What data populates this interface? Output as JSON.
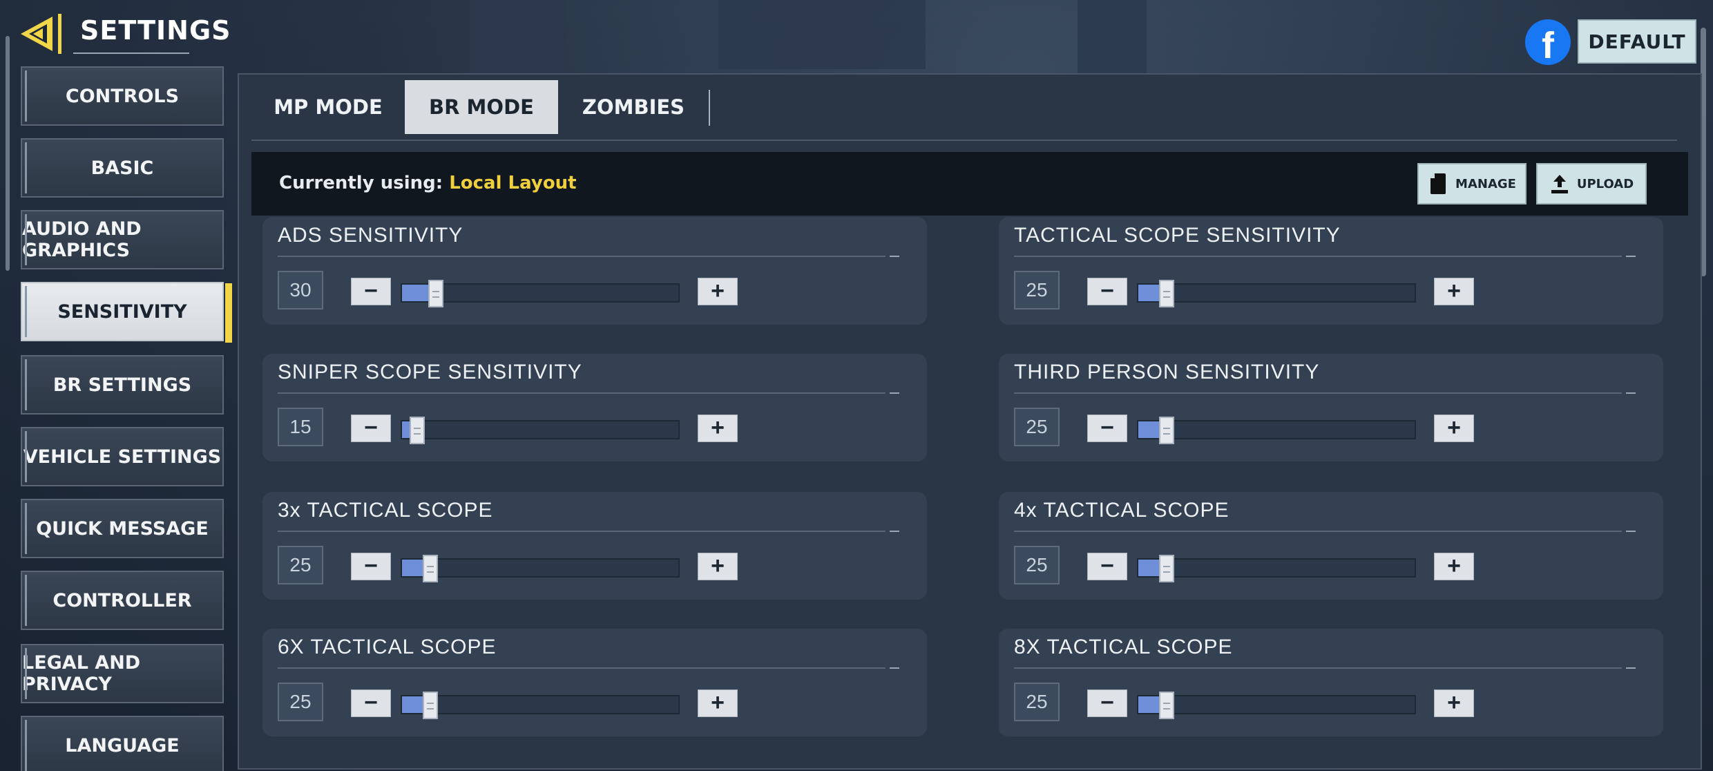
{
  "header": {
    "title": "SETTINGS",
    "default_label": "DEFAULT",
    "facebook_glyph": "f"
  },
  "sidebar": {
    "items": [
      {
        "label": "CONTROLS",
        "active": false
      },
      {
        "label": "BASIC",
        "active": false
      },
      {
        "label": "AUDIO AND GRAPHICS",
        "active": false
      },
      {
        "label": "SENSITIVITY",
        "active": true
      },
      {
        "label": "BR SETTINGS",
        "active": false
      },
      {
        "label": "VEHICLE SETTINGS",
        "active": false
      },
      {
        "label": "QUICK MESSAGE",
        "active": false
      },
      {
        "label": "CONTROLLER",
        "active": false
      },
      {
        "label": "LEGAL AND PRIVACY",
        "active": false
      },
      {
        "label": "LANGUAGE",
        "active": false
      }
    ]
  },
  "tabs": [
    {
      "label": "MP MODE",
      "active": false
    },
    {
      "label": "BR MODE",
      "active": true
    },
    {
      "label": "ZOMBIES",
      "active": false
    }
  ],
  "layout_bar": {
    "prefix": "Currently using:",
    "value": "Local Layout",
    "manage_label": "MANAGE",
    "upload_label": "UPLOAD"
  },
  "settings": [
    {
      "label": "ADS SENSITIVITY",
      "value": "30",
      "level": 0.1
    },
    {
      "label": "TACTICAL SCOPE SENSITIVITY",
      "value": "25",
      "level": 0.08
    },
    {
      "label": "SNIPER SCOPE SENSITIVITY",
      "value": "15",
      "level": 0.03
    },
    {
      "label": "THIRD PERSON SENSITIVITY",
      "value": "25",
      "level": 0.08
    },
    {
      "label": "3x TACTICAL SCOPE",
      "value": "25",
      "level": 0.08
    },
    {
      "label": "4x TACTICAL SCOPE",
      "value": "25",
      "level": 0.08
    },
    {
      "label": "6X TACTICAL SCOPE",
      "value": "25",
      "level": 0.08
    },
    {
      "label": "8X TACTICAL SCOPE",
      "value": "25",
      "level": 0.08
    }
  ],
  "stepper": {
    "minus": "−",
    "plus": "+"
  },
  "colors": {
    "accent_yellow": "#f2d64a",
    "slider_fill": "#6f8ed8",
    "facebook_blue": "#1877f2",
    "button_bg": "#cfe3e7"
  },
  "icons": {
    "back": "back-arrow-icon",
    "manage": "document-icon",
    "upload": "upload-icon"
  }
}
